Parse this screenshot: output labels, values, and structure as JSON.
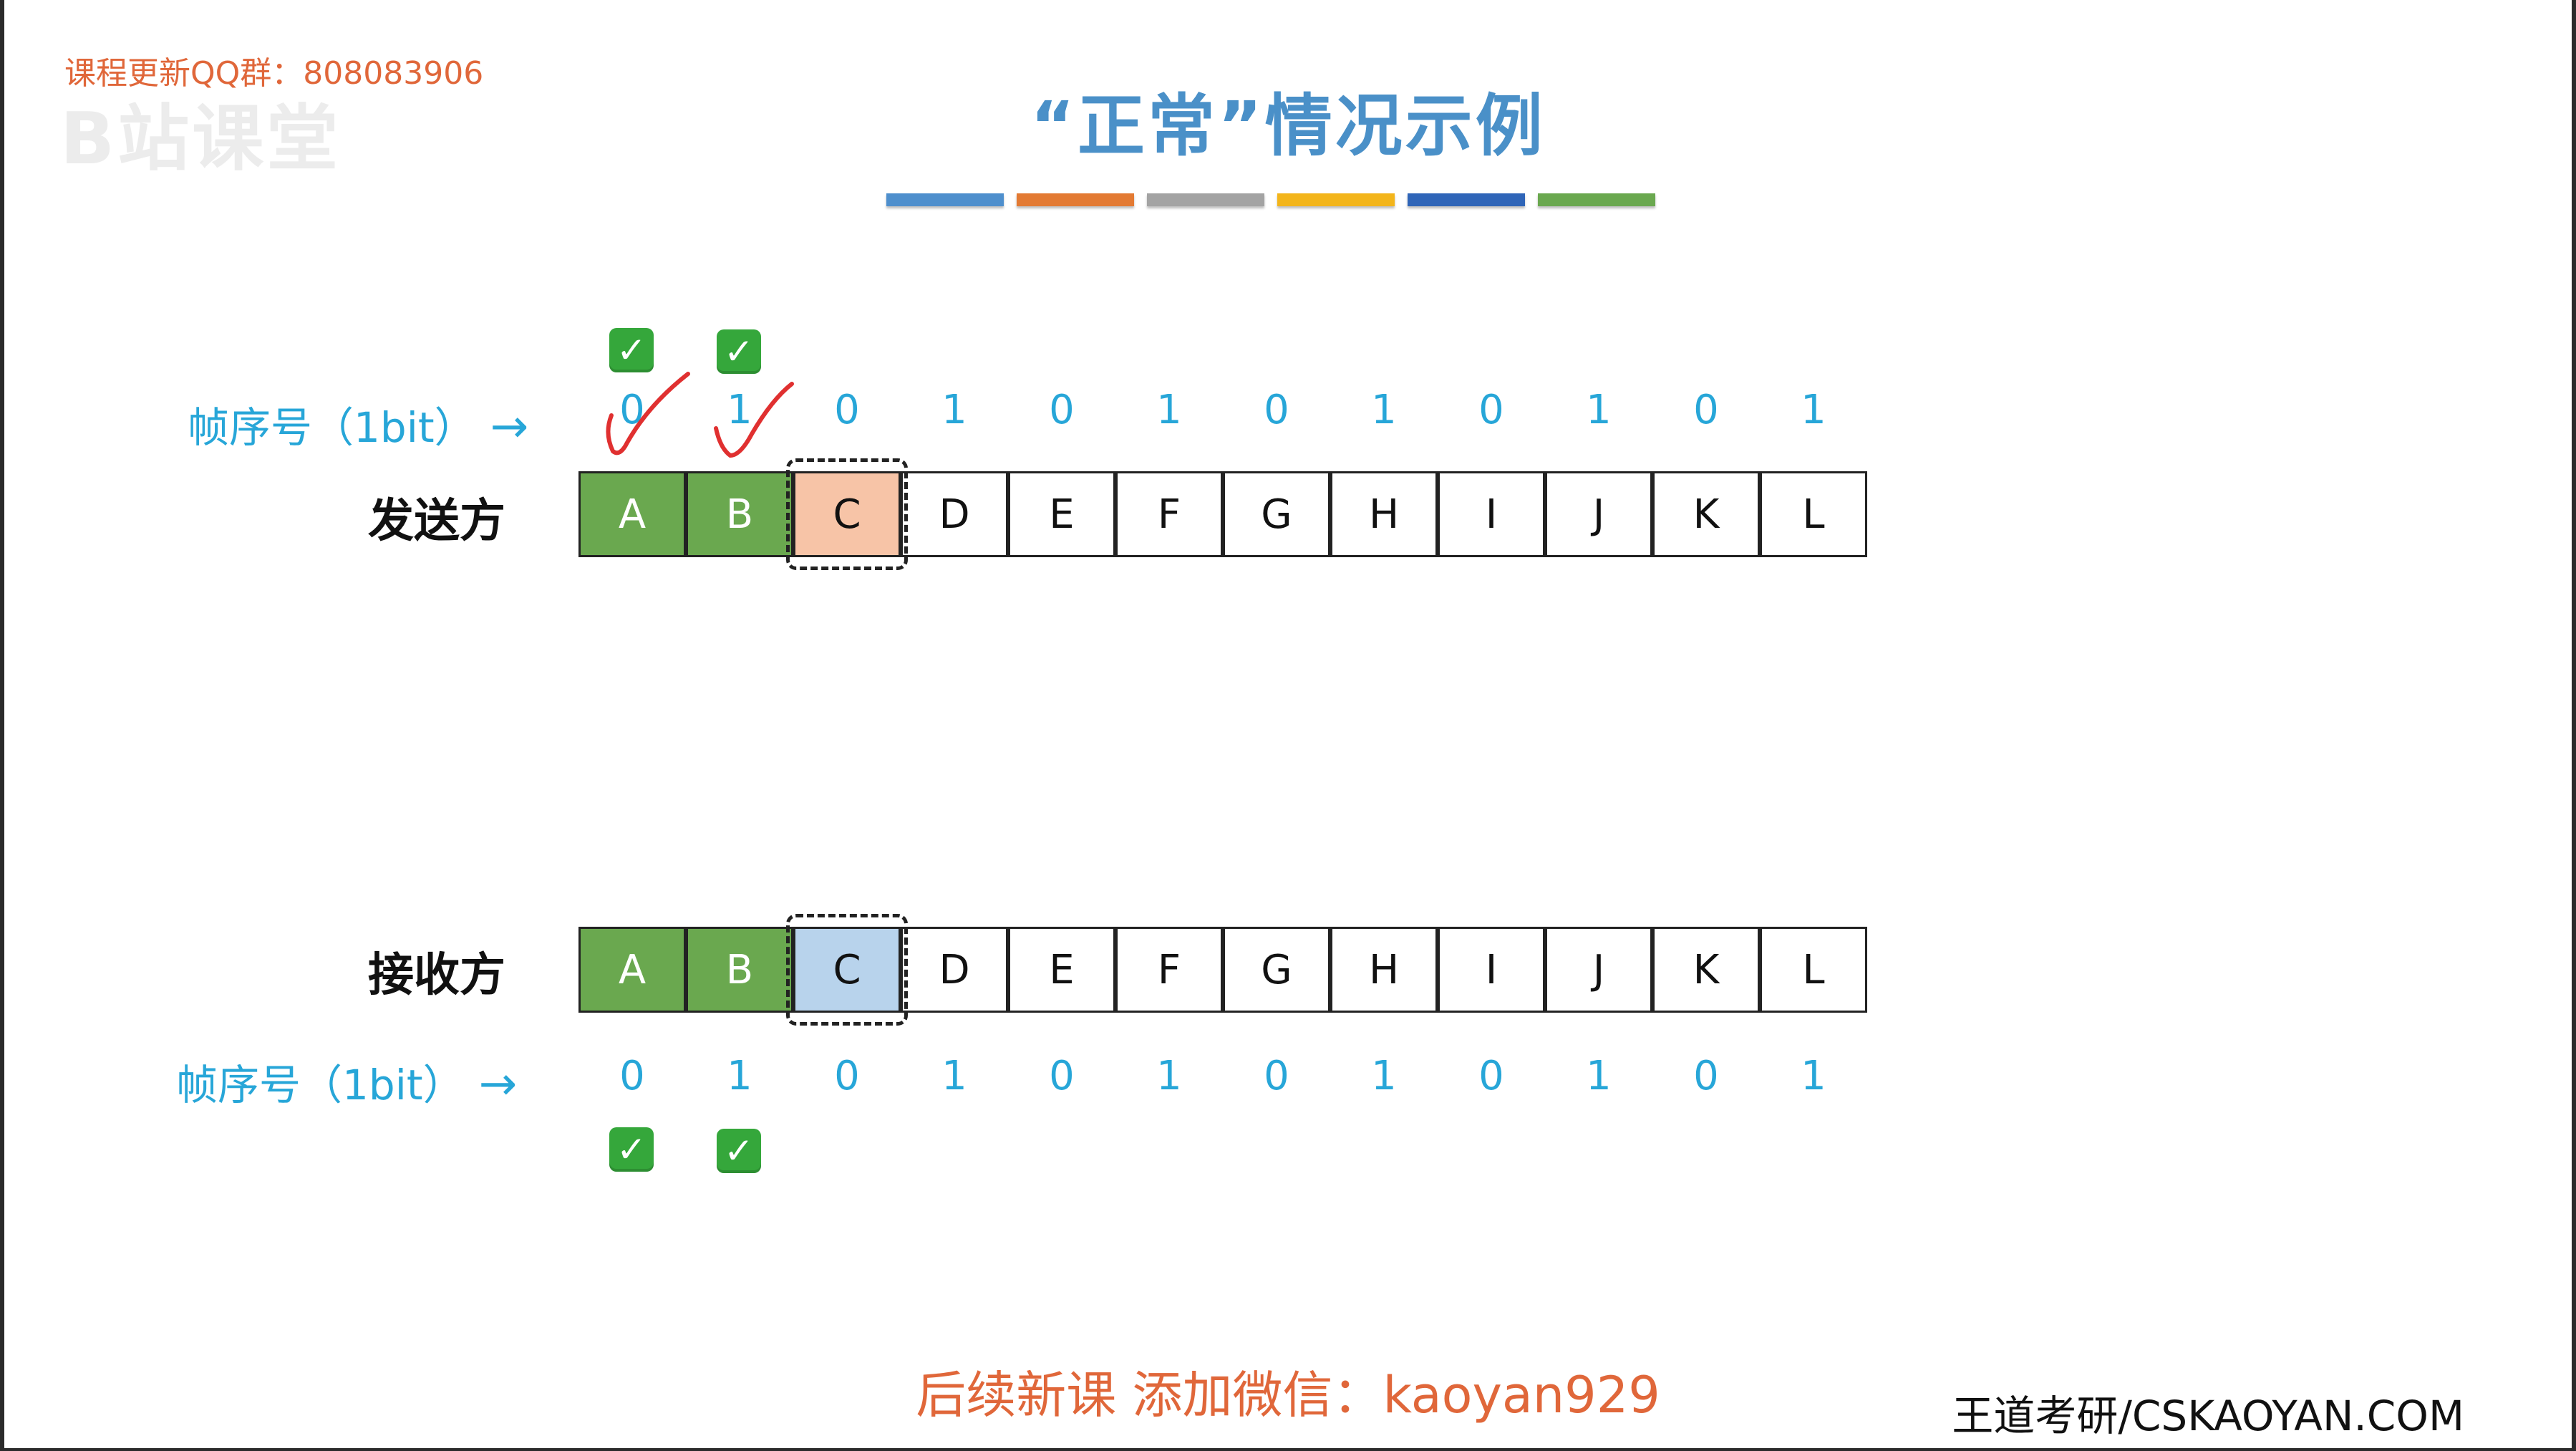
{
  "watermark": {
    "qq_text": "课程更新QQ群：808083906",
    "ghost_logo": "B站课堂"
  },
  "title": "“正常”情况示例",
  "color_bar_colors": [
    "#4e8fcd",
    "#e37a33",
    "#a3a3a3",
    "#f3b51b",
    "#2f65b8",
    "#6aa84f"
  ],
  "sender": {
    "label": "发送方",
    "seq_label": "帧序号（1bit）",
    "arrow": "→",
    "seq_numbers": [
      "0",
      "1",
      "0",
      "1",
      "0",
      "1",
      "0",
      "1",
      "0",
      "1",
      "0",
      "1"
    ],
    "frames": [
      "A",
      "B",
      "C",
      "D",
      "E",
      "F",
      "G",
      "H",
      "I",
      "J",
      "K",
      "L"
    ],
    "acked_count": 2,
    "window_index": 2,
    "window_color": "#f7c4a7"
  },
  "receiver": {
    "label": "接收方",
    "seq_label": "帧序号（1bit）",
    "arrow": "→",
    "seq_numbers": [
      "0",
      "1",
      "0",
      "1",
      "0",
      "1",
      "0",
      "1",
      "0",
      "1",
      "0",
      "1"
    ],
    "frames": [
      "A",
      "B",
      "C",
      "D",
      "E",
      "F",
      "G",
      "H",
      "I",
      "J",
      "K",
      "L"
    ],
    "acked_count": 2,
    "window_index": 2,
    "window_color": "#b8d3ec"
  },
  "checkmark": "✓",
  "footer": {
    "wechat": "后续新课 添加微信：kaoyan929",
    "brand": "王道考研/CSKAOYAN.COM"
  }
}
